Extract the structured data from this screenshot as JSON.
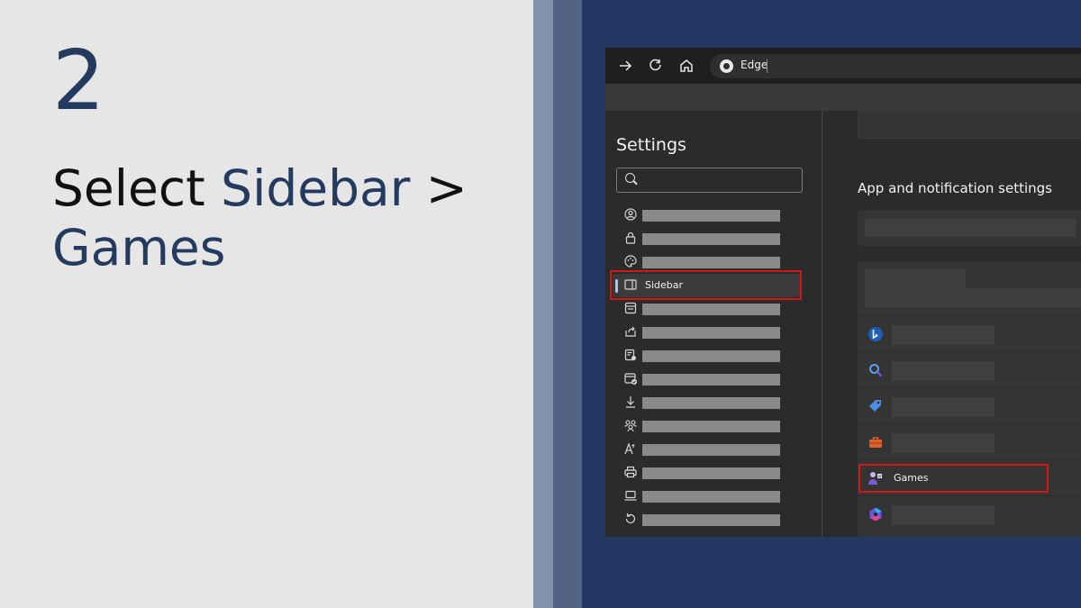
{
  "slide": {
    "step_number": "2",
    "instruction_prefix": "Select ",
    "instruction_hl1": "Sidebar",
    "instruction_separator": " > ",
    "instruction_hl2": "Games"
  },
  "browser": {
    "address_text": "Edge",
    "icons": {
      "forward": "arrow-right-icon",
      "refresh": "refresh-icon",
      "home": "home-icon",
      "logo": "edge-logo-icon"
    }
  },
  "settings": {
    "title": "Settings",
    "nav_items": [
      {
        "icon": "profile-icon"
      },
      {
        "icon": "lock-icon"
      },
      {
        "icon": "palette-icon"
      },
      {
        "icon": "sidebar-icon",
        "label": "Sidebar",
        "active": true
      },
      {
        "icon": "start-page-icon"
      },
      {
        "icon": "share-icon"
      },
      {
        "icon": "cookies-icon"
      },
      {
        "icon": "default-browser-icon"
      },
      {
        "icon": "download-icon"
      },
      {
        "icon": "family-icon"
      },
      {
        "icon": "languages-icon"
      },
      {
        "icon": "printer-icon"
      },
      {
        "icon": "system-icon"
      },
      {
        "icon": "reset-icon"
      }
    ]
  },
  "content": {
    "section_title": "App and notification settings",
    "rows": [
      {
        "icon": "bing-icon"
      },
      {
        "icon": "search-icon"
      },
      {
        "icon": "shopping-tag-icon"
      },
      {
        "icon": "tools-icon"
      },
      {
        "icon": "games-icon",
        "label": "Games"
      },
      {
        "icon": "copilot-icon"
      }
    ]
  },
  "colors": {
    "accent_text": "#243a5e",
    "highlight_box": "#d01818",
    "background_right": "#233862"
  }
}
